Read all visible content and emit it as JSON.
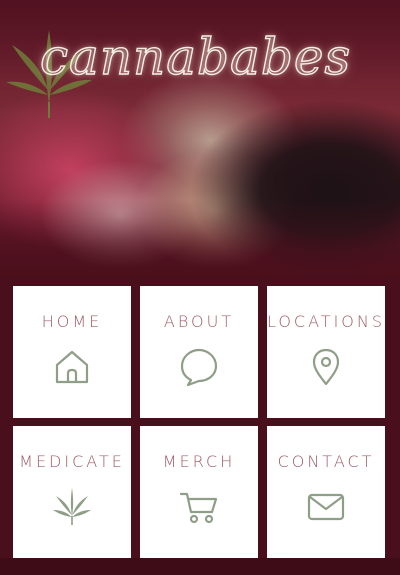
{
  "app": {
    "logo_text": "cannababes"
  },
  "nav": {
    "tiles": [
      {
        "label": "HOME",
        "icon": "home-icon"
      },
      {
        "label": "ABOUT",
        "icon": "speech-bubble-icon"
      },
      {
        "label": "LOCATIONS",
        "icon": "map-pin-icon"
      },
      {
        "label": "MEDICATE",
        "icon": "cannabis-leaf-icon"
      },
      {
        "label": "MERCH",
        "icon": "shopping-cart-icon"
      },
      {
        "label": "CONTACT",
        "icon": "envelope-icon"
      }
    ]
  },
  "colors": {
    "background": "#4a0f1c",
    "tile": "#ffffff",
    "label": "#9c5c68",
    "icon": "#8f9e86"
  }
}
